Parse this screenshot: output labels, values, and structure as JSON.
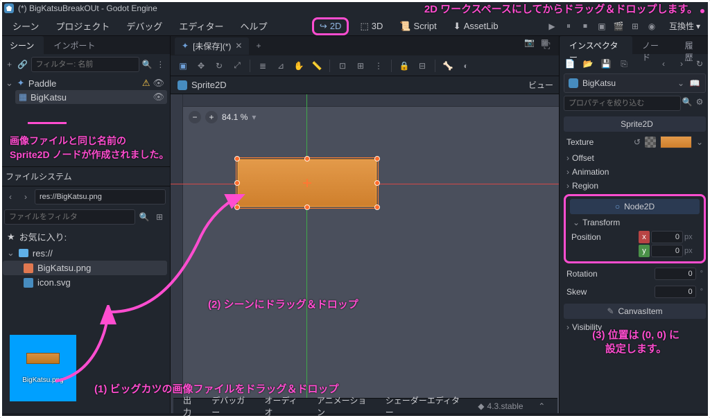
{
  "titlebar": {
    "text": "(*) BigKatsuBreakOUt - Godot Engine"
  },
  "top_annotation": "2D ワークスペースにしてからドラッグ＆ドロップします。",
  "menu": {
    "scene": "シーン",
    "project": "プロジェクト",
    "debug": "デバッグ",
    "editor": "エディター",
    "help": "ヘルプ"
  },
  "workspace": {
    "ws2d": "2D",
    "ws3d": "3D",
    "script": "Script",
    "assetlib": "AssetLib"
  },
  "compat": "互換性",
  "dock": {
    "scene": "シーン",
    "import": "インポート"
  },
  "scene_filter_placeholder": "フィルター: 名前",
  "tree": {
    "root": "Paddle",
    "child": "BigKatsu"
  },
  "annotation_node_created_1": "画像ファイルと同じ名前の",
  "annotation_node_created_2": "Sprite2D ノードが作成されました。",
  "filesystem": {
    "title": "ファイルシステム",
    "path": "res://BigKatsu.png",
    "filter_placeholder": "ファイルをフィルタ",
    "favorites": "お気に入り:",
    "root": "res://",
    "file1": "BigKatsu.png",
    "file2": "icon.svg"
  },
  "preview_caption": "BigKatsu.png",
  "scene_tab": "[未保存](*)",
  "crumb": "Sprite2D",
  "zoom": "84.1 %",
  "view_label": "ビュー",
  "annotation_2": "(2) シーンにドラッグ＆ドロップ",
  "annotation_1b": "(1) ビッグカツの画像ファイルをドラッグ＆ドロップ",
  "annotation_3a": "(3) 位置は (0, 0) に",
  "annotation_3b": "設定します。",
  "bottom": {
    "output": "出力",
    "debugger": "デバッガー",
    "audio": "オーディオ",
    "anim": "アニメーション",
    "shader": "シェーダーエディター",
    "version": "4.3.stable"
  },
  "inspector": {
    "tab_inspector": "インスペクター",
    "tab_node": "ノード",
    "tab_history": "履歴",
    "object": "BigKatsu",
    "filter_placeholder": "プロパティを絞り込む",
    "class_sprite2d": "Sprite2D",
    "texture_label": "Texture",
    "offset": "Offset",
    "animation": "Animation",
    "region": "Region",
    "class_node2d": "Node2D",
    "transform": "Transform",
    "position": "Position",
    "x_val": "0",
    "y_val": "0",
    "unit": "px",
    "rotation": "Rotation",
    "rotation_val": "0",
    "deg": "°",
    "skew": "Skew",
    "skew_val": "0",
    "canvasitem": "CanvasItem",
    "visibility": "Visibility"
  }
}
